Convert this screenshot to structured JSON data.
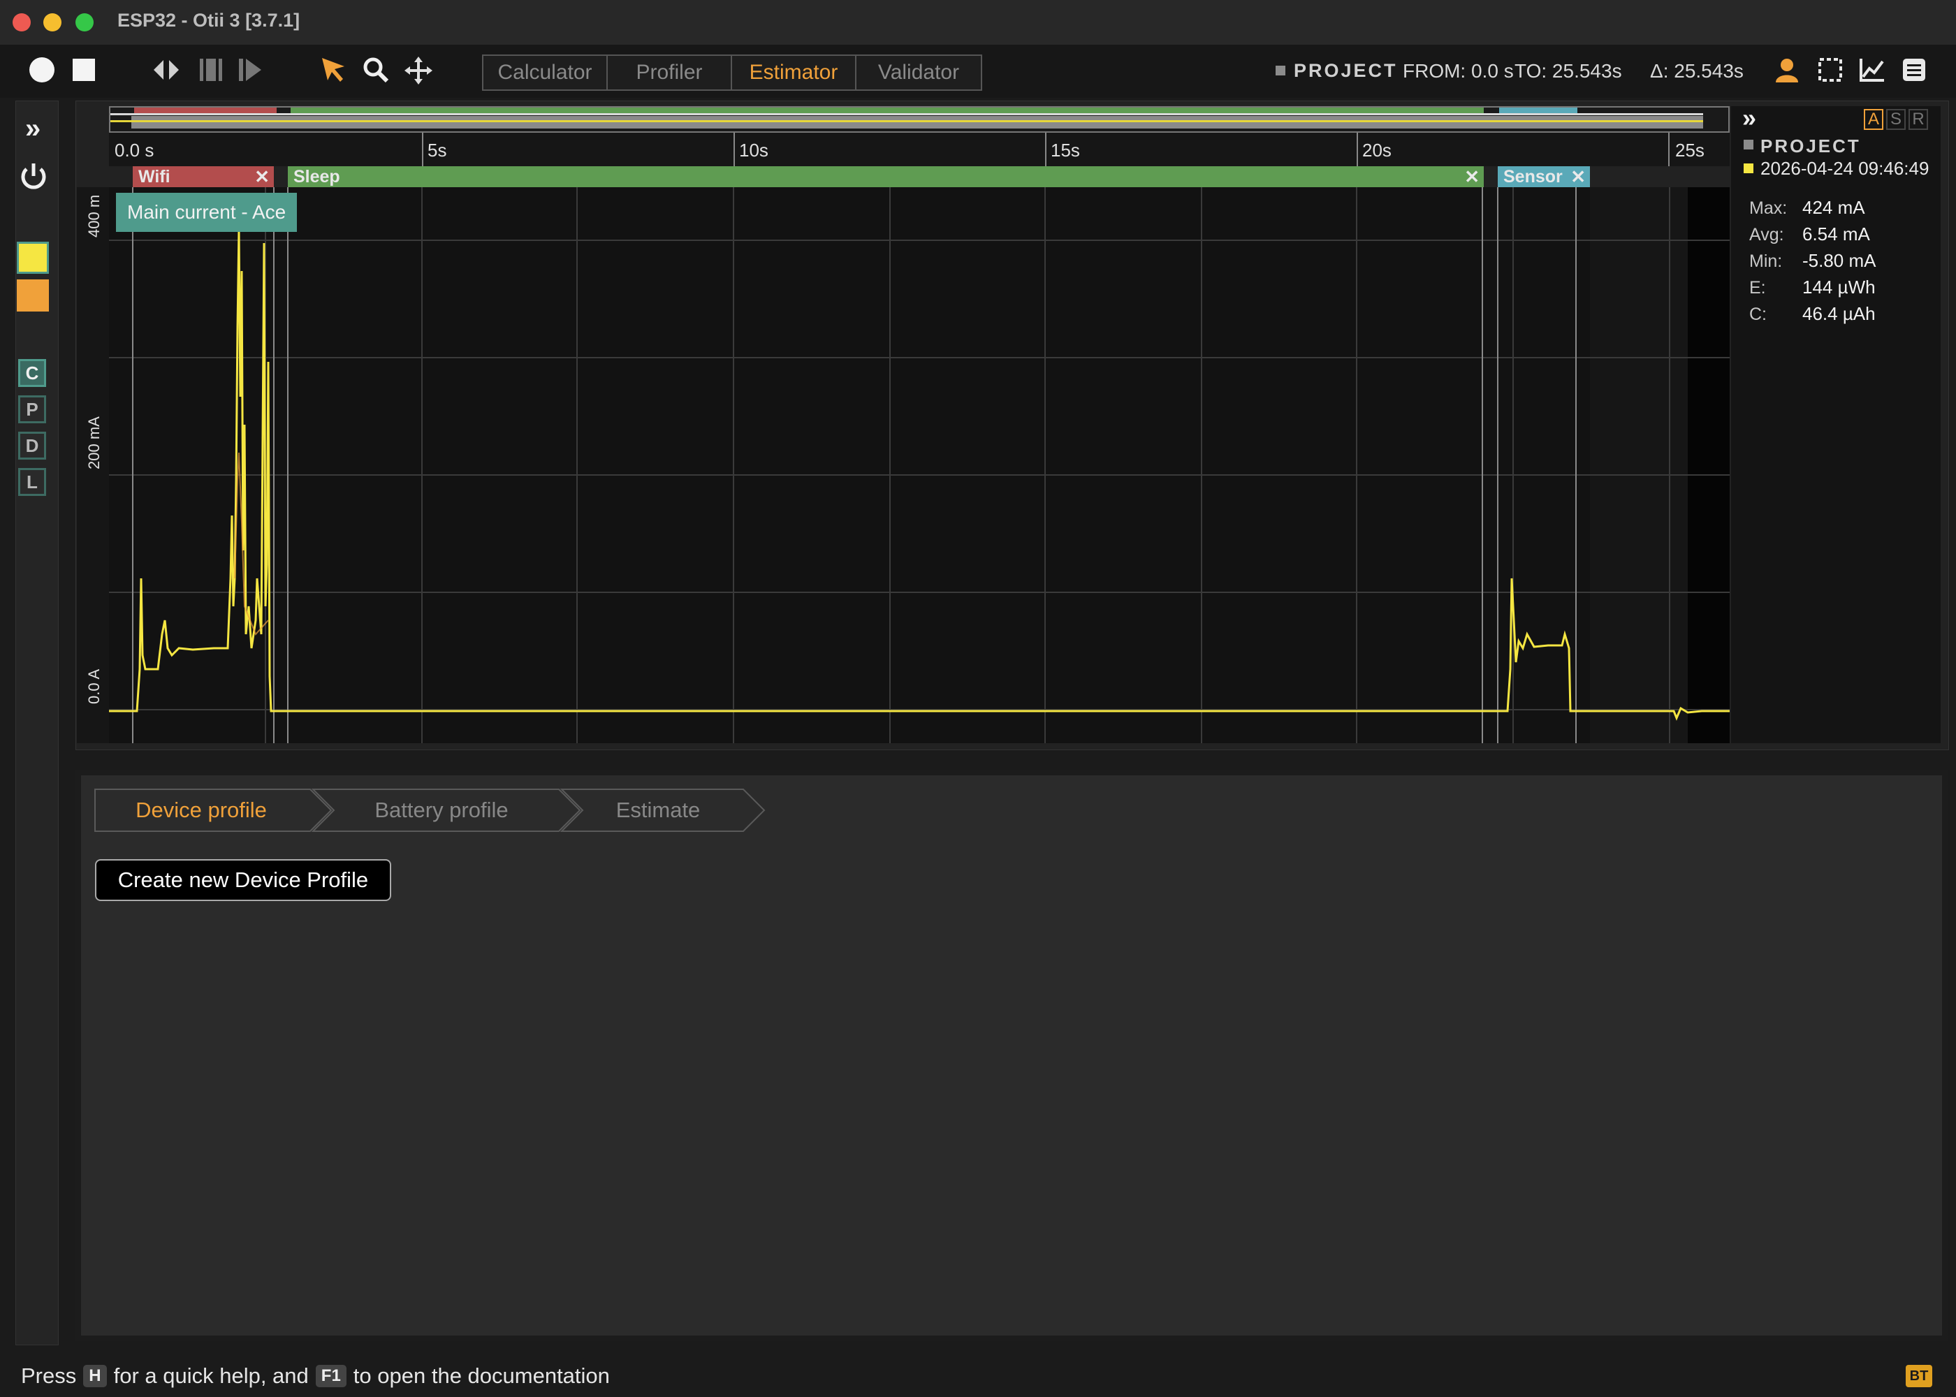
{
  "window": {
    "title": "ESP32 - Otii 3 [3.7.1]"
  },
  "toolbar": {
    "tabs": [
      {
        "label": "Calculator"
      },
      {
        "label": "Profiler"
      },
      {
        "label": "Estimator"
      },
      {
        "label": "Validator"
      }
    ],
    "active_tab": "Estimator",
    "project_label": "PROJECT",
    "from": "FROM: 0.0 s",
    "to": "TO: 25.543s",
    "delta": "Δ: 25.543s"
  },
  "sidebar": {
    "expand": "»",
    "channel_colors": [
      "#f5e642",
      "#f0a13a"
    ],
    "channel_buttons": [
      "C",
      "P",
      "D",
      "L"
    ]
  },
  "plot": {
    "ticks": [
      "0.0 s",
      "5s",
      "10s",
      "15s",
      "20s",
      "25s"
    ],
    "y_labels": [
      "400 m",
      "200 mA",
      "0.0 A"
    ],
    "channel_tag": "Main current - Ace",
    "marks": [
      {
        "label": "Wifi",
        "close": "✕",
        "color": "#b34d4d"
      },
      {
        "label": "Sleep",
        "close": "✕",
        "color": "#5f9c52"
      },
      {
        "label": "Sensor",
        "close": "✕",
        "color": "#5aa9b8"
      }
    ],
    "trace_color": "#f5e642"
  },
  "stats": {
    "expand": "»",
    "asr": [
      "A",
      "S",
      "R"
    ],
    "project": "PROJECT",
    "recording": "2026-04-24 09:46:49",
    "rows": [
      {
        "label": "Max:",
        "value": "424 mA"
      },
      {
        "label": "Avg:",
        "value": "6.54 mA"
      },
      {
        "label": "Min:",
        "value": "-5.80 mA"
      },
      {
        "label": "E:",
        "value": "144 µWh"
      },
      {
        "label": "C:",
        "value": "46.4 µAh"
      }
    ]
  },
  "estimator": {
    "steps": [
      "Device profile",
      "Battery profile",
      "Estimate"
    ],
    "create_button": "Create new Device Profile"
  },
  "status": {
    "press": "Press",
    "key_h": "H",
    "mid": "for a quick help, and",
    "key_f1": "F1",
    "end": "to open the documentation",
    "badge": "BT"
  }
}
